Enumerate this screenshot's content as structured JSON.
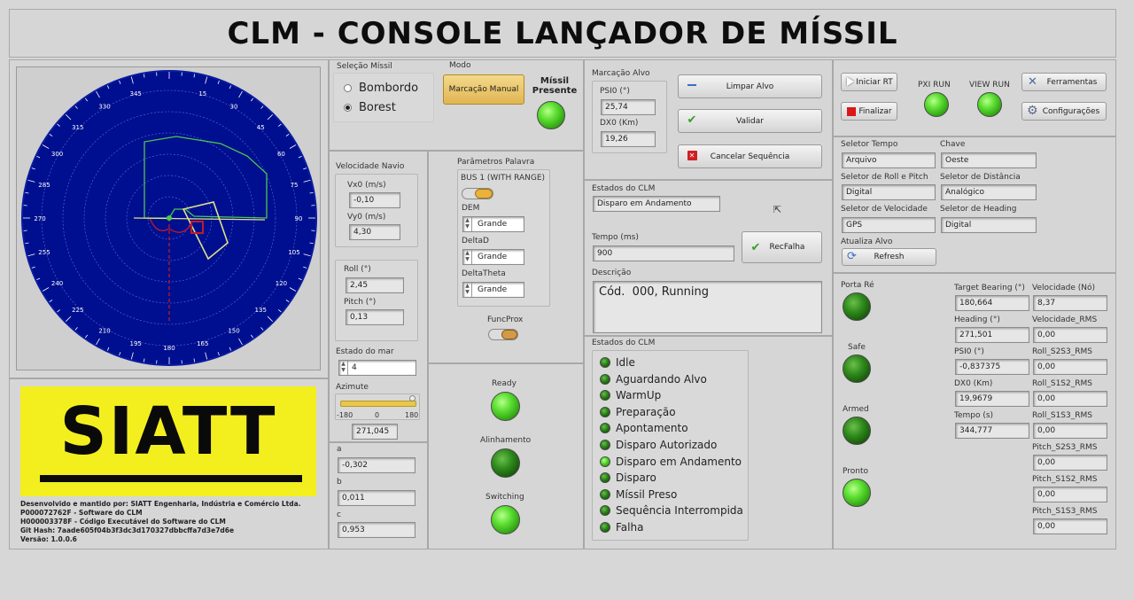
{
  "title": "CLM - CONSOLE LANÇADOR DE MÍSSIL",
  "radar": {
    "bearings": [
      "345",
      "330",
      "315",
      "300",
      "285",
      "270",
      "255",
      "240",
      "225",
      "210",
      "195",
      "180",
      "165",
      "150",
      "135",
      "120",
      "105",
      "90",
      "75",
      "60",
      "45",
      "30",
      "15"
    ],
    "colors": {
      "dial": "#000f8f",
      "dial_edge": "#0a1c9e",
      "ring": "#5c6fd8",
      "contact": "#e0e08a",
      "track": "#c01a2a",
      "zone": "#4dc84d"
    }
  },
  "logo": {
    "text": "SIATT",
    "bg_color": "#f3ef1f",
    "info_lines": [
      "Desenvolvido e mantido por: SIATT Engenharia, Indústria e Comércio Ltda.",
      "P000072762F - Software do CLM",
      "H000003378F - Código Executável do Software do CLM",
      "Git Hash: 7aade605f04b3f3dc3d170327dbbcffa7d3e7d6e",
      "Versão: 1.0.0.6"
    ]
  },
  "selecao": {
    "label": "Seleção Míssil",
    "options": [
      "Bombordo",
      "Borest"
    ],
    "selected": "Borest",
    "modo_label": "Modo",
    "modo_button": "Marcação Manual",
    "missil_label": "Míssil Presente"
  },
  "velocidade": {
    "label": "Velocidade Navio",
    "vx_label": "Vx0 (m/s)",
    "vx": "-0,10",
    "vy_label": "Vy0 (m/s)",
    "vy": "4,30"
  },
  "atitude": {
    "roll_label": "Roll (°)",
    "roll": "2,45",
    "pitch_label": "Pitch (°)",
    "pitch": "0,13"
  },
  "mar": {
    "label": "Estado do mar",
    "value": "4"
  },
  "azimute": {
    "label": "Azimute",
    "min": "-180",
    "mid": "0",
    "max": "180",
    "value": "271,045"
  },
  "coef": {
    "a_label": "a",
    "a": "-0,302",
    "b_label": "b",
    "b": "0,011",
    "c_label": "c",
    "c": "0,953"
  },
  "palavra": {
    "label": "Parâmetros Palavra",
    "bus_label": "BUS 1 (WITH RANGE)",
    "dem_label": "DEM",
    "dem": "Grande",
    "deltad_label": "DeltaD",
    "deltad": "Grande",
    "deltatheta_label": "DeltaTheta",
    "deltatheta": "Grande",
    "funcprox_label": "FuncProx"
  },
  "leds_mid": {
    "ready": "Ready",
    "alinhamento": "Alinhamento",
    "switching": "Switching"
  },
  "marcacao": {
    "label": "Marcação Alvo",
    "psi_label": "PSI0 (°)",
    "psi": "25,74",
    "dx_label": "DX0 (Km)",
    "dx": "19,26",
    "limpar": "Limpar Alvo",
    "validar": "Validar",
    "cancelar": "Cancelar Sequência"
  },
  "estados_top": {
    "label": "Estados do CLM",
    "value": "Disparo em Andamento",
    "tempo_label": "Tempo (ms)",
    "tempo": "900",
    "recfalha": "RecFalha",
    "descricao_label": "Descrição",
    "descricao": "Cód.  000, Running"
  },
  "estados_list": {
    "label": "Estados do CLM",
    "items": [
      "Idle",
      "Aguardando Alvo",
      "WarmUp",
      "Preparação",
      "Apontamento",
      "Disparo Autorizado",
      "Disparo em Andamento",
      "Disparo",
      "Míssil Preso",
      "Sequência Interrompida",
      "Falha"
    ],
    "active": "Disparo em Andamento"
  },
  "controle": {
    "iniciar": "Iniciar RT",
    "finalizar": "Finalizar",
    "pxi": "PXI RUN",
    "view": "VIEW RUN",
    "ferramentas": "Ferramentas",
    "configuracoes": "Configurações"
  },
  "seletores": {
    "tempo_label": "Seletor Tempo",
    "tempo": "Arquivo",
    "chave_label": "Chave",
    "chave": "Oeste",
    "roll_label": "Seletor de Roll e Pitch",
    "roll": "Digital",
    "dist_label": "Seletor de Distância",
    "dist": "Analógico",
    "vel_label": "Seletor de Velocidade",
    "vel": "GPS",
    "head_label": "Seletor de Heading",
    "head": "Digital",
    "atualiza_label": "Atualiza Alvo",
    "refresh": "Refresh"
  },
  "status_leds": {
    "porta": "Porta Ré",
    "safe": "Safe",
    "armed": "Armed",
    "pronto": "Pronto"
  },
  "target": {
    "bearing_label": "Target Bearing (°)",
    "bearing": "180,664",
    "heading_label": "Heading (°)",
    "heading": "271,501",
    "psi_label": "PSI0 (°)",
    "psi": "-0,837375",
    "dx_label": "DX0 (Km)",
    "dx": "19,9679",
    "tempo_label": "Tempo (s)",
    "tempo": "344,777"
  },
  "rms": {
    "vel_label": "Velocidade (Nó)",
    "vel": "8,37",
    "vel_rms_label": "Velocidade_RMS",
    "vel_rms": "0,00",
    "r23_label": "Roll_S2S3_RMS",
    "r23": "0,00",
    "r12_label": "Roll_S1S2_RMS",
    "r12": "0,00",
    "r13_label": "Roll_S1S3_RMS",
    "r13": "0,00",
    "p23_label": "Pitch_S2S3_RMS",
    "p23": "0,00",
    "p12_label": "Pitch_S1S2_RMS",
    "p12": "0,00",
    "p13_label": "Pitch_S1S3_RMS",
    "p13": "0,00"
  }
}
